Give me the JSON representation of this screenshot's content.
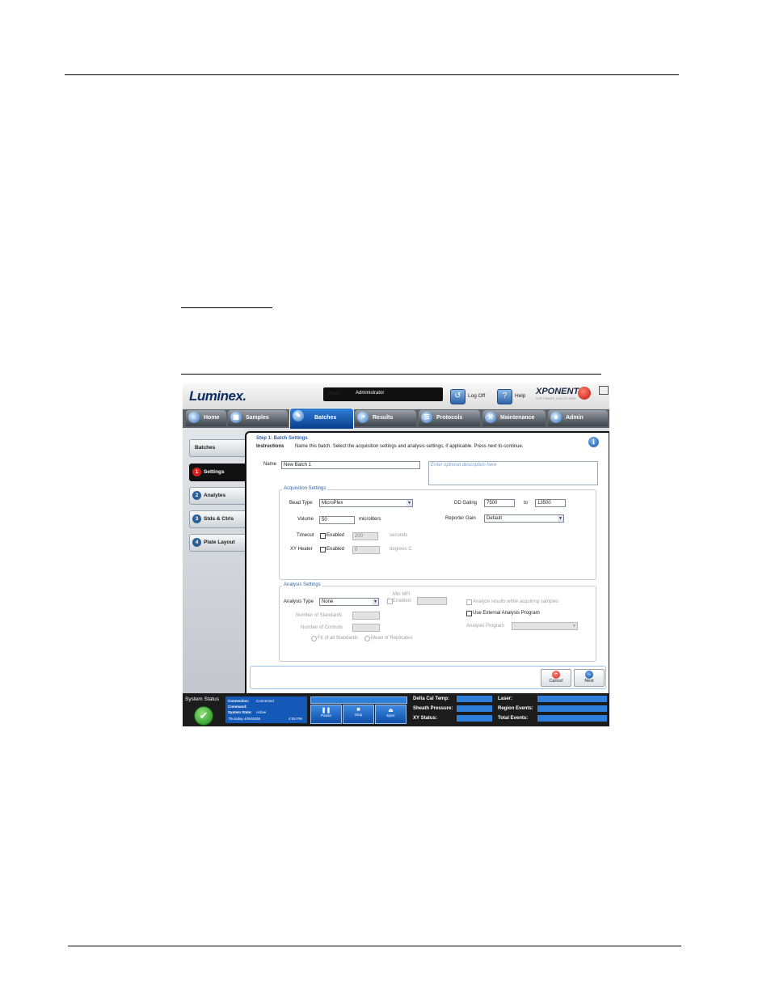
{
  "app": {
    "logo": "Luminex.",
    "user_label": "User:",
    "user_name": "Administrator",
    "logoff_label": "Log Off",
    "help_label": "Help",
    "brand": "XPONENT",
    "brand_sub": "SOFTWARE SOLUTIONS"
  },
  "nav": {
    "tabs": [
      "Home",
      "Samples",
      "Batches",
      "Results",
      "Protocols",
      "Maintenance",
      "Admin"
    ]
  },
  "sidebar": {
    "title": "Batches",
    "items": [
      {
        "num": "1",
        "label": "Settings"
      },
      {
        "num": "2",
        "label": "Analytes"
      },
      {
        "num": "3",
        "label": "Stds & Ctrls"
      },
      {
        "num": "4",
        "label": "Plate Layout"
      }
    ]
  },
  "main": {
    "step_title": "Step 1: Batch Settings",
    "instructions_label": "Instructions",
    "instructions_text": "Name this batch. Select the acquisition settings and analysis settings, if applicable. Press next to continue.",
    "name_label": "Name",
    "name_value": "New Batch 1",
    "description_placeholder": "Enter optional description here",
    "acquisition": {
      "title": "Acquisition Settings",
      "bead_type_label": "Bead Type",
      "bead_type_value": "MicroPlex",
      "volume_label": "Volume",
      "volume_value": "50",
      "volume_unit": "microliters",
      "timeout_label": "Timeout",
      "enabled_label": "Enabled",
      "timeout_value": "200",
      "timeout_unit": "seconds",
      "xy_heater_label": "XY Heater",
      "xy_heater_value": "0",
      "xy_heater_unit": "degrees C",
      "dd_gating_label": "DD Gating",
      "dd_gating_from": "7500",
      "dd_gating_to_label": "to",
      "dd_gating_to": "13500",
      "reporter_gain_label": "Reporter Gain",
      "reporter_gain_value": "Default"
    },
    "analysis": {
      "title": "Analysis Settings",
      "analysis_type_label": "Analysis Type",
      "analysis_type_value": "None",
      "min_mfi_label": "Min MFI",
      "min_mfi_enabled": "Enabled",
      "num_standards_label": "Number of Standards",
      "num_controls_label": "Number of Controls",
      "fit_label": "Fit of all Standards",
      "mean_label": "Mean of Replicates",
      "analyze_while_label": "Analyze results while acquiring samples",
      "use_external_label": "Use External Analysis Program",
      "analysis_program_label": "Analysis Program"
    },
    "cancel_label": "Cancel",
    "next_label": "Next"
  },
  "status": {
    "system_status_label": "System Status",
    "connection_label": "Connection:",
    "connection_value": "Connected",
    "command_label": "Command:",
    "system_state_label": "System State:",
    "system_state_value": "Active",
    "date": "Thursday 4/08/2008",
    "time": "4:06 PM",
    "pause_label": "Pause",
    "stop_label": "Stop",
    "eject_label": "Eject",
    "delta_cal_temp_label": "Delta Cal Temp:",
    "sheath_pressure_label": "Sheath Pressure:",
    "xy_status_label": "XY Status:",
    "laser_label": "Laser:",
    "region_events_label": "Region Events:",
    "total_events_label": "Total Events:"
  }
}
